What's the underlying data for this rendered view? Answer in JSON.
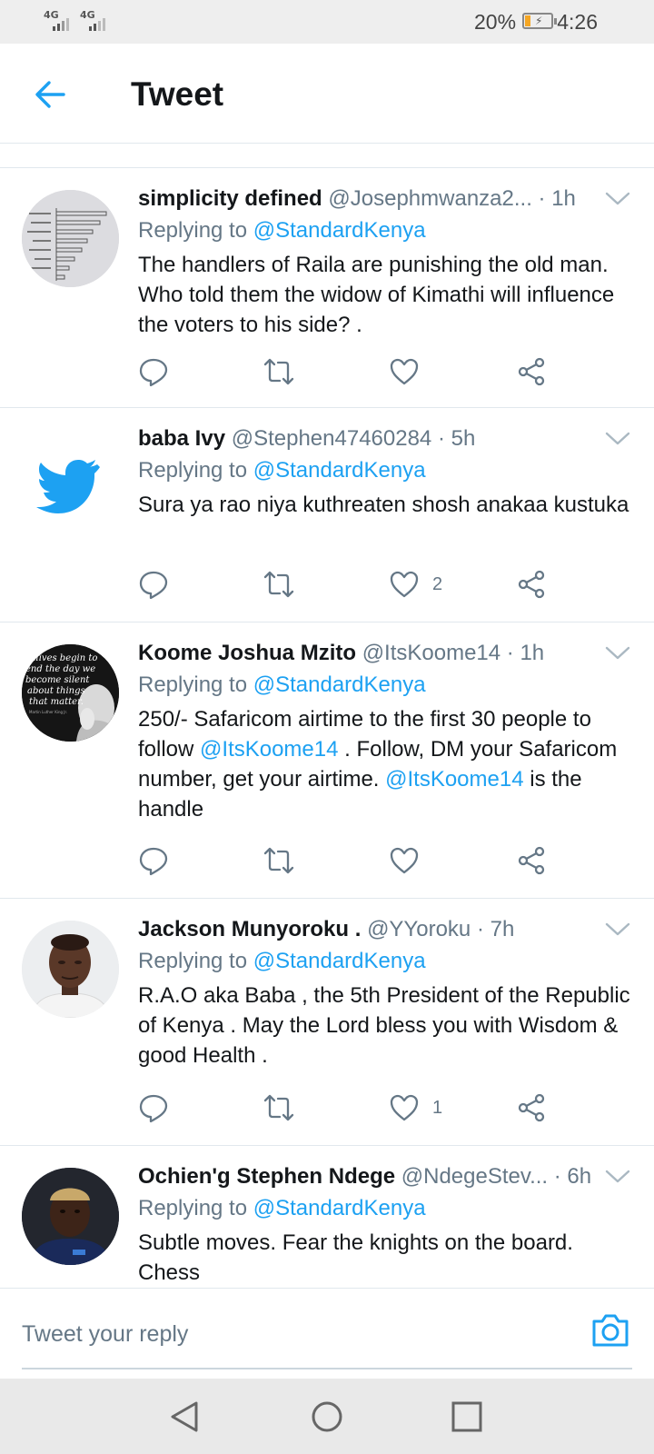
{
  "status_bar": {
    "signal_1": "4G",
    "signal_2": "4G",
    "battery_percent": "20%",
    "battery_level": 0.2,
    "time": "4:26"
  },
  "header": {
    "title": "Tweet",
    "back_icon": "arrow-left-icon"
  },
  "colors": {
    "accent": "#1da1f2",
    "secondary_text": "#657786",
    "divider": "#e1e8ed"
  },
  "tweets": [
    {
      "name": "simplicity defined",
      "handle": "@Josephmwanza2...",
      "time": "· 1h",
      "replying_label": "Replying to",
      "replying_to": "@StandardKenya",
      "text_parts": [
        "The handlers of Raila are punishing the old man. Who told them the widow of Kimathi will influence the voters to his side? ."
      ],
      "likes": ""
    },
    {
      "name": "baba Ivy",
      "handle": "@Stephen47460284",
      "time": "· 5h",
      "replying_label": "Replying to",
      "replying_to": "@StandardKenya",
      "text_parts": [
        "Sura ya rao niya kuthreaten shosh anakaa kustuka"
      ],
      "likes": "2"
    },
    {
      "name": "Koome Joshua Mzito",
      "handle": "@ItsKoome14",
      "time": "· 1h",
      "replying_label": "Replying to",
      "replying_to": "@StandardKenya",
      "text_parts": [
        "250/- Safaricom airtime to the first 30 people to follow ",
        "@ItsKoome14",
        " . Follow, DM your Safaricom number, get your airtime. ",
        "@ItsKoome14",
        " is the handle"
      ],
      "likes": "",
      "avatar_text": [
        "...lives begin to",
        "end the day we",
        "become silent",
        "about things",
        "that matter.",
        "Martin Luther King Jr."
      ]
    },
    {
      "name": "Jackson Munyoroku .",
      "handle": "@YYoroku",
      "time": "· 7h",
      "replying_label": "Replying to",
      "replying_to": "@StandardKenya",
      "text_parts": [
        "R.A.O aka Baba , the 5th President of the Republic of Kenya . May the Lord bless you with Wisdom & good  Health ."
      ],
      "likes": "1"
    },
    {
      "name": "Ochien'g Stephen Ndege",
      "handle": "@NdegeStev...",
      "time": "· 6h",
      "replying_label": "Replying to",
      "replying_to": "@StandardKenya",
      "text_parts": [
        "Subtle moves. Fear the knights on the board. Chess"
      ],
      "likes": ""
    }
  ],
  "reply_bar": {
    "placeholder": "Tweet your reply",
    "camera_icon": "camera-icon"
  },
  "nav_bar": {
    "back": "triangle-back-icon",
    "home": "circle-home-icon",
    "recents": "square-recents-icon"
  }
}
